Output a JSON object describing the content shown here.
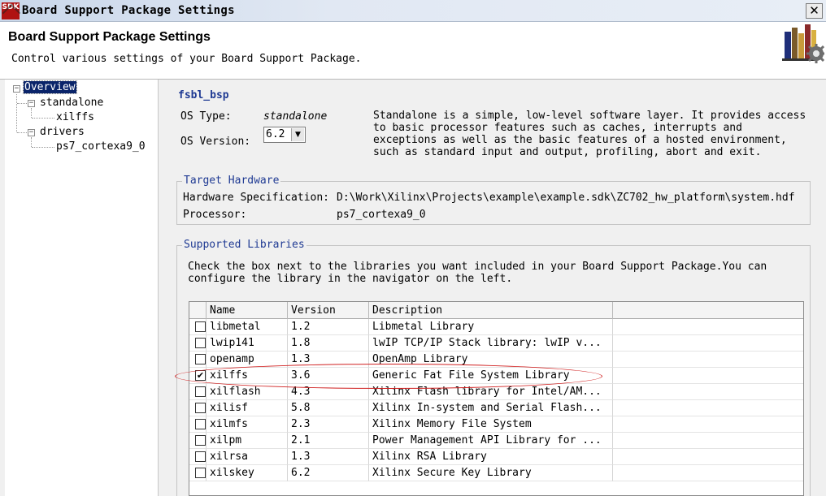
{
  "window": {
    "title": "Board Support Package Settings",
    "app_icon": "sdk-icon",
    "app_icon_text": "SDK",
    "close_glyph": "✕"
  },
  "header": {
    "title": "Board Support Package Settings",
    "description": "Control various settings of your Board Support Package."
  },
  "navigator": {
    "overview": "Overview",
    "standalone": "standalone",
    "xilffs": "xilffs",
    "drivers": "drivers",
    "cpu_driver": "ps7_cortexa9_0",
    "toggle_glyph": "−"
  },
  "content": {
    "bsp_name": "fsbl_bsp",
    "os_type_label": "OS Type:",
    "os_type_value": "standalone",
    "os_version_label": "OS Version:",
    "os_version_value": "6.2",
    "os_description": "Standalone is a simple, low-level software layer. It provides access to basic processor features such as caches, interrupts and exceptions as well as the basic features of a hosted environment, such as standard input and output, profiling, abort and exit.",
    "target_hardware": {
      "title": "Target Hardware",
      "hw_spec_label": "Hardware Specification:",
      "hw_spec_value": "D:\\Work\\Xilinx\\Projects\\example\\example.sdk\\ZC702_hw_platform\\system.hdf",
      "processor_label": "Processor:",
      "processor_value": "ps7_cortexa9_0"
    },
    "supported_libraries": {
      "title": "Supported Libraries",
      "instructions": "Check the box next to the libraries you want included in your Board Support Package.You can configure the library in the navigator on the left.",
      "columns": [
        "Name",
        "Version",
        "Description"
      ],
      "rows": [
        {
          "name": "libmetal",
          "version": "1.2",
          "description": "Libmetal Library",
          "checked": false
        },
        {
          "name": "lwip141",
          "version": "1.8",
          "description": "lwIP TCP/IP Stack library: lwIP v...",
          "checked": false
        },
        {
          "name": "openamp",
          "version": "1.3",
          "description": "OpenAmp Library",
          "checked": false
        },
        {
          "name": "xilffs",
          "version": "3.6",
          "description": "Generic Fat File System Library",
          "checked": true
        },
        {
          "name": "xilflash",
          "version": "4.3",
          "description": "Xilinx Flash library for Intel/AM...",
          "checked": false
        },
        {
          "name": "xilisf",
          "version": "5.8",
          "description": "Xilinx In-system and Serial Flash...",
          "checked": false
        },
        {
          "name": "xilmfs",
          "version": "2.3",
          "description": "Xilinx Memory File System",
          "checked": false
        },
        {
          "name": "xilpm",
          "version": "2.1",
          "description": "Power Management API Library for ...",
          "checked": false
        },
        {
          "name": "xilrsa",
          "version": "1.3",
          "description": "Xilinx RSA Library",
          "checked": false
        },
        {
          "name": "xilskey",
          "version": "6.2",
          "description": "Xilinx Secure Key Library",
          "checked": false
        }
      ]
    }
  },
  "colors": {
    "section_title": "#1f3a93",
    "selection": "#0a246a",
    "annotation": "#d02020"
  }
}
